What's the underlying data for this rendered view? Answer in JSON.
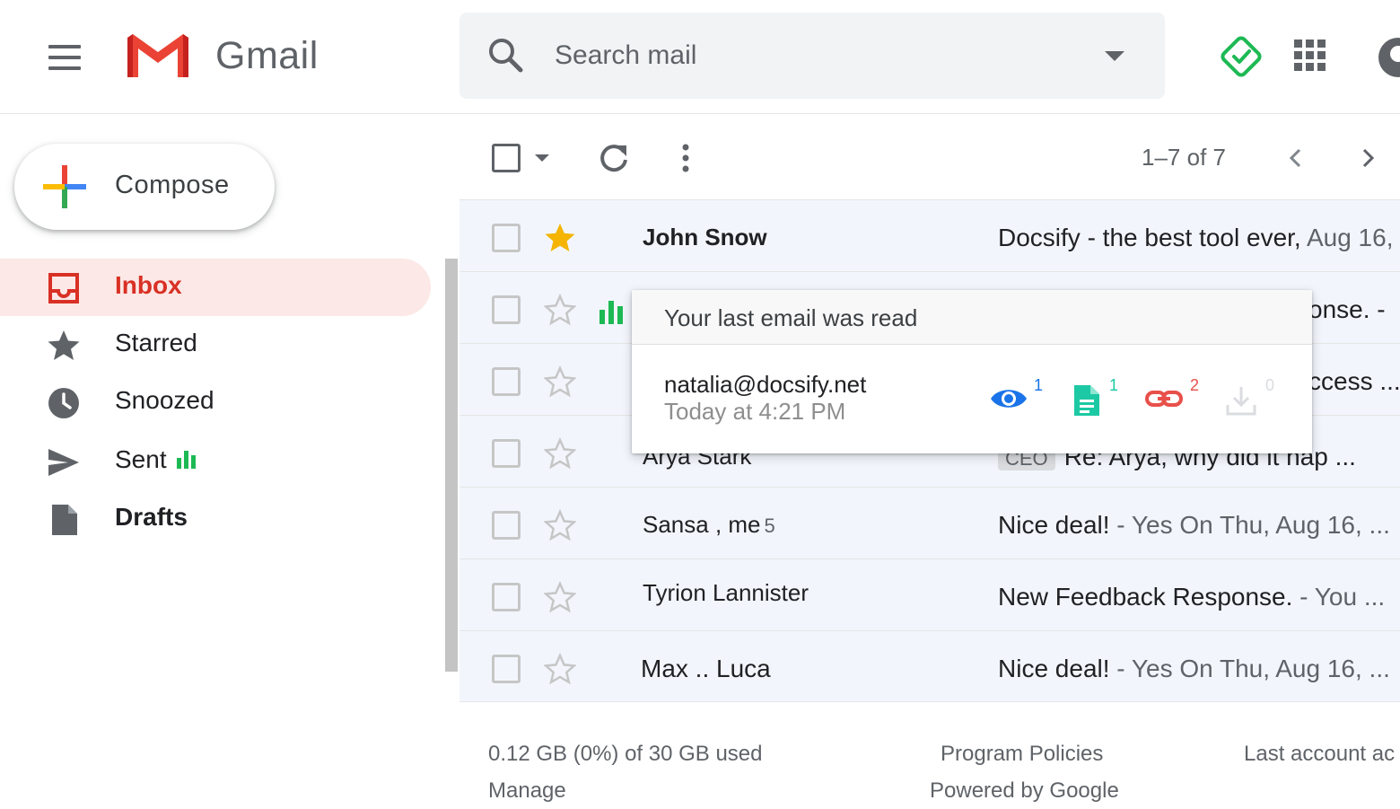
{
  "header": {
    "app_name": "Gmail",
    "search_placeholder": "Search mail"
  },
  "sidebar": {
    "compose_label": "Compose",
    "items": [
      {
        "label": "Inbox",
        "icon": "inbox-icon",
        "active": true
      },
      {
        "label": "Starred",
        "icon": "star-icon"
      },
      {
        "label": "Snoozed",
        "icon": "clock-icon"
      },
      {
        "label": "Sent",
        "icon": "send-icon"
      },
      {
        "label": "Drafts",
        "icon": "draft-icon"
      }
    ]
  },
  "toolbar": {
    "page_count": "1–7 of 7"
  },
  "emails": [
    {
      "sender": "John Snow",
      "count": "",
      "subject": "Docsify - the best tool ever,",
      "snippet": " Aug 16,",
      "starred": true
    },
    {
      "sender": "",
      "count": "",
      "subject": "",
      "snippet": "onse. -",
      "starred": false,
      "tracked": true
    },
    {
      "sender": "",
      "count": "",
      "subject": "",
      "snippet": "ccess ...",
      "starred": false
    },
    {
      "sender": "Arya Stark",
      "count": "",
      "label": "CEO",
      "subject": "Re:",
      "snippet": "  Arya, why did it hap   ...",
      "starred": false
    },
    {
      "sender": "Sansa , me",
      "count": "5",
      "subject": "Nice deal!",
      "snippet": " - Yes On Thu, Aug 16, ...",
      "starred": false
    },
    {
      "sender": "Tyrion Lannister",
      "count": "",
      "subject": "New Feedback Response.",
      "snippet": " - You ...",
      "starred": false
    },
    {
      "sender": "Max .. Luca",
      "count": "",
      "subject": "Nice deal!",
      "snippet": " - Yes On Thu, Aug 16, ...",
      "starred": false
    }
  ],
  "popup": {
    "title": "Your last email was read",
    "email": "natalia@docsify.net",
    "time": "Today at 4:21 PM",
    "metrics": {
      "views": "1",
      "documents": "1",
      "links": "2",
      "downloads": "0"
    }
  },
  "footer": {
    "storage": "0.12 GB (0%) of 30 GB used",
    "manage": "Manage",
    "policies": "Program Policies",
    "powered": "Powered by Google",
    "last_activity": "Last account ac"
  },
  "colors": {
    "inbox_active_bg": "#fce8e6",
    "inbox_active_text": "#d93025",
    "row_bg": "#f2f6fc",
    "star_gold": "#f4b400",
    "docsify_green": "#1db954",
    "view_blue": "#1a73e8",
    "doc_teal": "#1dc9a4",
    "link_red": "#e8504a"
  }
}
